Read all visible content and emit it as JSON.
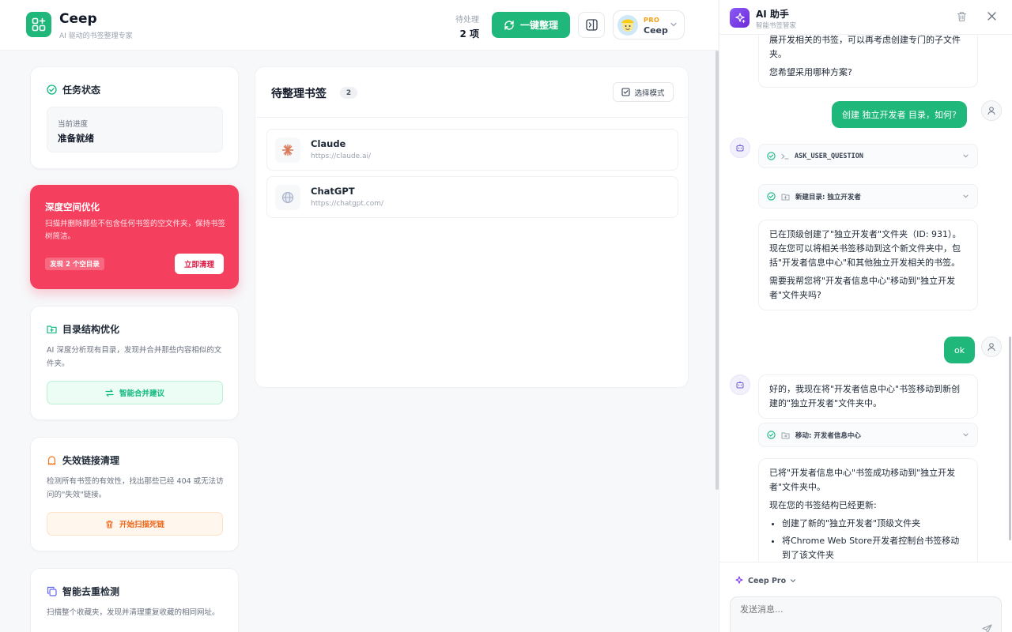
{
  "header": {
    "app_name": "Ceep",
    "app_subtitle": "AI 驱动的书签整理专家",
    "pending_label": "待处理",
    "pending_count": "2 项",
    "organize_button": "一键整理",
    "profile": {
      "tier": "PRO",
      "name": "Ceep"
    }
  },
  "task_status": {
    "title": "任务状态",
    "progress_label": "当前进度",
    "progress_value": "准备就绪"
  },
  "deep_clean": {
    "title": "深度空间优化",
    "desc": "扫描并删除那些不包含任何书签的空文件夹，保持书签树简洁。",
    "tag": "发现 2 个空目录",
    "button": "立即清理"
  },
  "structure": {
    "title": "目录结构优化",
    "desc": "AI 深度分析现有目录，发现并合并那些内容相似的文件夹。",
    "button": "智能合并建议"
  },
  "dead_links": {
    "title": "失效链接清理",
    "desc": "检测所有书签的有效性，找出那些已经 404 或无法访问的\"失效\"链接。",
    "button": "开始扫描死链"
  },
  "dedupe": {
    "title": "智能去重检测",
    "desc": "扫描整个收藏夹，发现并清理重复收藏的相同网址。"
  },
  "bookmarks": {
    "title": "待整理书签",
    "count": "2",
    "select_mode": "选择模式",
    "items": [
      {
        "name": "Claude",
        "url": "https://claude.ai/"
      },
      {
        "name": "ChatGPT",
        "url": "https://chatgpt.com/"
      }
    ]
  },
  "chat": {
    "title": "AI 助手",
    "subtitle": "智能书签管家",
    "messages": {
      "m0_line1": "展开发相关的书签，可以再考虑创建专门的子文件夹。",
      "m0_line2": "您希望采用哪种方案?",
      "u1": "创建 独立开发者 目录，如何?",
      "tool1": "ASK_USER_QUESTION",
      "tool2": "新建目录: 独立开发者",
      "m3_p1": "已在顶级创建了\"独立开发者\"文件夹（ID: 931）。现在您可以将相关书签移动到这个新文件夹中，包括\"开发者信息中心\"和其他独立开发相关的书签。",
      "m3_p2": "需要我帮您将\"开发者信息中心\"移动到\"独立开发者\"文件夹吗?",
      "u2": "ok",
      "m5": "好的，我现在将\"开发者信息中心\"书签移动到新创建的\"独立开发者\"文件夹中。",
      "tool3": "移动: 开发者信息中心",
      "m7_p1": "已将\"开发者信息中心\"书签成功移动到\"独立开发者\"文件夹中。",
      "m7_p2": "现在您的书签结构已经更新:",
      "m7_li1": "创建了新的\"独立开发者\"顶级文件夹",
      "m7_li2": "将Chrome Web Store开发者控制台书签移动到了该文件夹"
    },
    "model": "Ceep Pro",
    "input_placeholder": "发送消息..."
  },
  "colors": {
    "brand": "#1fb77a",
    "danger": "#f43f5e",
    "warning": "#ef6a1f",
    "accent_purple": "#7c3aed"
  }
}
